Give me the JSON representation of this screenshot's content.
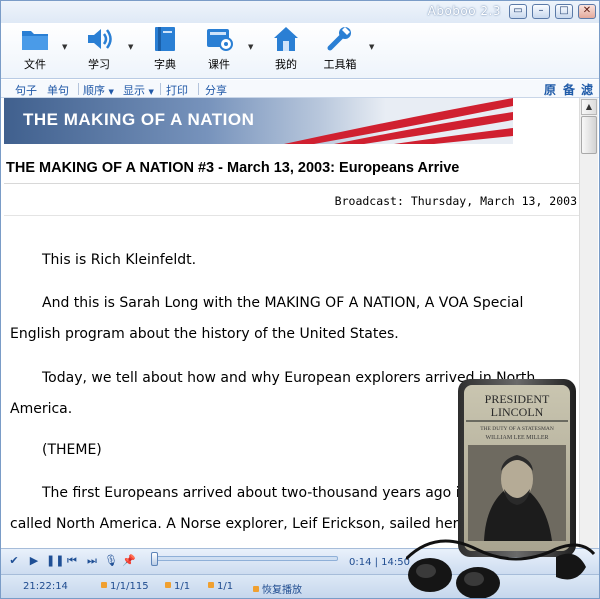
{
  "window": {
    "title": "Aboboo 2.3"
  },
  "toolbar": {
    "items": [
      {
        "label": "文件",
        "icon": "folder-icon"
      },
      {
        "label": "学习",
        "icon": "speaker-icon"
      },
      {
        "label": "字典",
        "icon": "book-icon"
      },
      {
        "label": "课件",
        "icon": "courseware-icon"
      },
      {
        "label": "我的",
        "icon": "home-icon"
      },
      {
        "label": "工具箱",
        "icon": "wrench-icon"
      }
    ]
  },
  "menu": {
    "items": [
      "句子",
      "单句",
      "顺序",
      "显示",
      "打印",
      "分享"
    ],
    "right": [
      "原",
      "备",
      "滤"
    ]
  },
  "article": {
    "banner": "THE MAKING OF A NATION",
    "title": "THE MAKING OF A NATION #3 - March 13, 2003: Europeans Arrive",
    "broadcast": "Broadcast: Thursday, March 13, 2003",
    "paragraphs": [
      "This is Rich Kleinfeldt.",
      "And this is Sarah Long with the MAKING OF A NATION, A VOA Special English program about the history of the United States.",
      "Today, we tell about how and why European explorers arrived in North America.",
      "(THEME)",
      "The first Europeans arrived about two-thousand years ago in what is now called North America. A Norse explorer, Leif Erickson, sailed here."
    ]
  },
  "player": {
    "time": "0:14 | 14:50",
    "progress": 0.016
  },
  "status": {
    "clock": "21:22:14",
    "items": [
      "1/1/115",
      "1/1",
      "1/1",
      "恢复播放"
    ]
  },
  "overlay": {
    "book_title_1": "PRESIDENT",
    "book_title_2": "LINCOLN",
    "book_subtitle": "THE DUTY OF A STATESMAN",
    "book_author": "WILLIAM LEE MILLER"
  }
}
